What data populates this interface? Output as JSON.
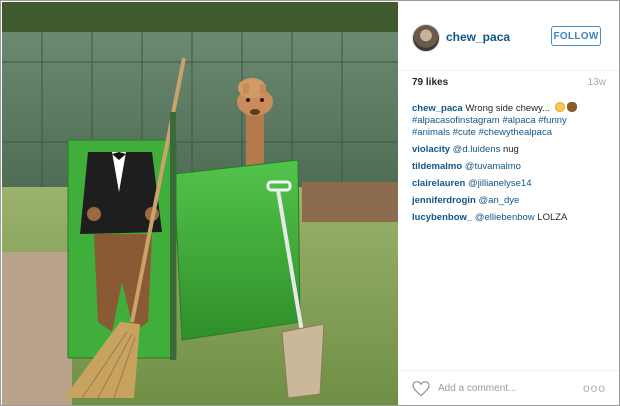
{
  "post": {
    "username": "chew_paca",
    "follow_label": "FOLLOW",
    "likes": "79 likes",
    "age": "13w"
  },
  "caption": {
    "user": "chew_paca",
    "text": "Wrong side chewy... ",
    "emoji": [
      "crying-laughing-emoji",
      "poop-emoji"
    ],
    "hashtags": [
      "#alpacasofinstagram",
      "#alpaca",
      "#funny",
      "#animals",
      "#cute",
      "#chewythealpaca"
    ]
  },
  "comments": [
    {
      "user": "violacity",
      "mention": "@d.luidens",
      "text": "nug"
    },
    {
      "user": "tildemalmo",
      "mention": "@tuvamalmo",
      "text": ""
    },
    {
      "user": "clairelauren",
      "mention": "@jillianelyse14",
      "text": ""
    },
    {
      "user": "jenniferdrogin",
      "mention": "@an_dye",
      "text": ""
    },
    {
      "user": "lucybenbow_",
      "mention": "@elliebenbow",
      "text": "LOLZA"
    }
  ],
  "footer": {
    "add_comment_placeholder": "Add a comment...",
    "more_label": "ooo"
  },
  "colors": {
    "link": "#125688",
    "follow_border": "#4a8cc7",
    "board_green": "#3fae3a"
  }
}
